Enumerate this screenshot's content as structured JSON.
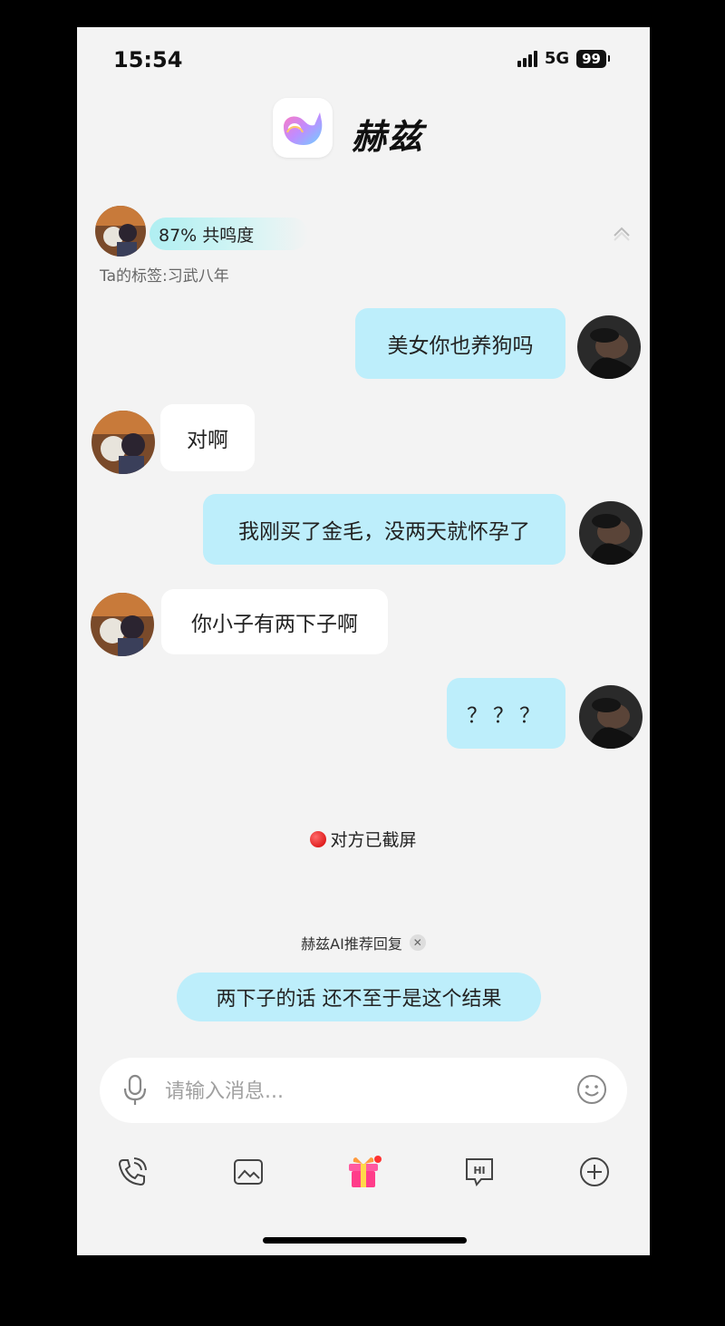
{
  "status_bar": {
    "time": "15:54",
    "network": "5G",
    "battery": "99"
  },
  "header": {
    "app_name": "赫兹",
    "logo_icon": "whale-logo-icon"
  },
  "match": {
    "resonance": "87% 共鸣度",
    "tag_line": "Ta的标签:习武八年"
  },
  "messages": [
    {
      "side": "out",
      "text": "美女你也养狗吗"
    },
    {
      "side": "in",
      "text": "对啊"
    },
    {
      "side": "out",
      "text": "我刚买了金毛，没两天就怀孕了"
    },
    {
      "side": "in",
      "text": "你小子有两下子啊"
    },
    {
      "side": "out",
      "text": "？？？"
    }
  ],
  "system_notice": "对方已截屏",
  "ai_suggest": {
    "label": "赫兹AI推荐回复",
    "reply": "两下子的话 还不至于是这个结果"
  },
  "composer": {
    "placeholder": "请输入消息..."
  },
  "toolbar": [
    "phone-call-icon",
    "image-icon",
    "gift-icon",
    "hi-greeting-icon",
    "plus-icon"
  ],
  "colors": {
    "outgoing_bubble": "#bdeefb",
    "incoming_bubble": "#ffffff",
    "background": "#f3f3f3"
  }
}
